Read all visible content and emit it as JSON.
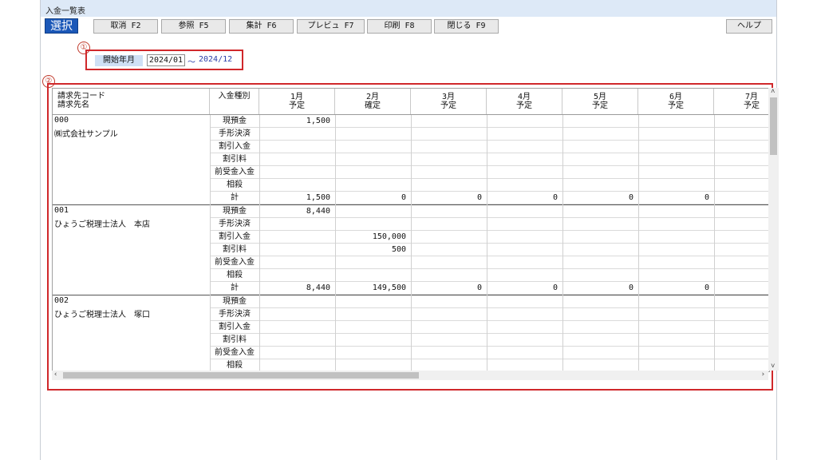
{
  "window": {
    "title": "入金一覧表"
  },
  "toolbar": {
    "select": "選択",
    "buttons": [
      "取消 F2",
      "参照 F5",
      "集計 F6",
      "プレビュ F7",
      "印刷 F8",
      "閉じる F9"
    ],
    "help": "ヘルプ"
  },
  "markers": [
    "①",
    "②"
  ],
  "period": {
    "label": "開始年月",
    "from": "2024/01",
    "separator": "～",
    "to": "2024/12"
  },
  "grid": {
    "header": {
      "customer_code": "請求先コード",
      "customer_name": "請求先名",
      "type": "入金種別",
      "months": [
        {
          "month": "1月",
          "status": "予定"
        },
        {
          "month": "2月",
          "status": "確定"
        },
        {
          "month": "3月",
          "status": "予定"
        },
        {
          "month": "4月",
          "status": "予定"
        },
        {
          "month": "5月",
          "status": "予定"
        },
        {
          "month": "6月",
          "status": "予定"
        },
        {
          "month": "7月",
          "status": "予定"
        }
      ]
    },
    "type_labels": [
      "現預金",
      "手形決済",
      "割引入金",
      "割引料",
      "前受金入金",
      "相殺",
      "計"
    ],
    "groups": [
      {
        "code": "000",
        "name": "㈱式会社サンプル",
        "values": [
          [
            "1,500",
            "",
            "",
            "",
            "",
            ""
          ],
          [
            "",
            "",
            "",
            "",
            "",
            ""
          ],
          [
            "",
            "",
            "",
            "",
            "",
            ""
          ],
          [
            "",
            "",
            "",
            "",
            "",
            ""
          ],
          [
            "",
            "",
            "",
            "",
            "",
            ""
          ],
          [
            "",
            "",
            "",
            "",
            "",
            ""
          ],
          [
            "1,500",
            "0",
            "0",
            "0",
            "0",
            "0"
          ]
        ]
      },
      {
        "code": "001",
        "name": "ひょうご税理士法人　本店",
        "values": [
          [
            "8,440",
            "",
            "",
            "",
            "",
            ""
          ],
          [
            "",
            "",
            "",
            "",
            "",
            ""
          ],
          [
            "",
            "150,000",
            "",
            "",
            "",
            ""
          ],
          [
            "",
            "500",
            "",
            "",
            "",
            ""
          ],
          [
            "",
            "",
            "",
            "",
            "",
            ""
          ],
          [
            "",
            "",
            "",
            "",
            "",
            ""
          ],
          [
            "8,440",
            "149,500",
            "0",
            "0",
            "0",
            "0"
          ]
        ]
      },
      {
        "code": "002",
        "name": "ひょうご税理士法人　塚口",
        "values": [
          [
            "",
            "",
            "",
            "",
            "",
            ""
          ],
          [
            "",
            "",
            "",
            "",
            "",
            ""
          ],
          [
            "",
            "",
            "",
            "",
            "",
            ""
          ],
          [
            "",
            "",
            "",
            "",
            "",
            ""
          ],
          [
            "",
            "",
            "",
            "",
            "",
            ""
          ],
          [
            "",
            "",
            "",
            "",
            "",
            ""
          ],
          [
            "",
            "",
            "",
            "",
            "",
            ""
          ]
        ]
      }
    ]
  },
  "colors": {
    "highlight_box": "#d0282b",
    "select_button": "#1b58b8",
    "title_bar": "#dde9f7",
    "period_label_bg": "#cfe0f5",
    "period_to_text": "#2a3ea8"
  }
}
